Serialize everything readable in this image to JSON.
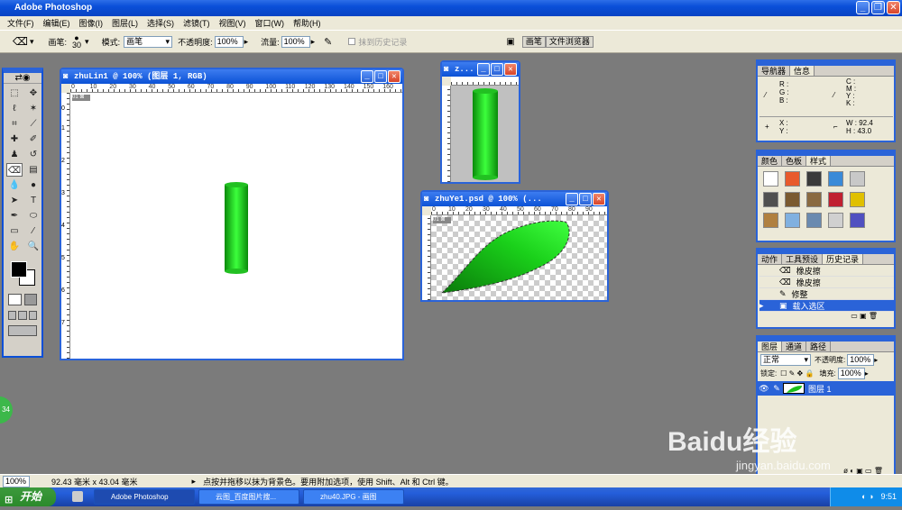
{
  "app": {
    "title": "Adobe Photoshop"
  },
  "menu": [
    "文件(F)",
    "编辑(E)",
    "图像(I)",
    "图层(L)",
    "选择(S)",
    "滤镜(T)",
    "视图(V)",
    "窗口(W)",
    "帮助(H)"
  ],
  "options": {
    "brush_label": "画笔:",
    "brush_size": "30",
    "mode_label": "模式:",
    "mode_value": "画笔",
    "opacity_label": "不透明度:",
    "opacity_value": "100%",
    "flow_label": "流量:",
    "flow_value": "100%",
    "history_label": "抹到历史记录",
    "tab1": "画笔",
    "tab2": "文件浏览器"
  },
  "doc1": {
    "title": "zhuLin1 @ 100% (图层 1, RGB)",
    "ruler_ticks": [
      "0",
      "10",
      "20",
      "30",
      "40",
      "50",
      "60",
      "70",
      "80",
      "90",
      "100",
      "110",
      "120",
      "130",
      "140",
      "150",
      "160"
    ],
    "vruler": [
      "0",
      "1",
      "2",
      "3",
      "4",
      "5",
      "6",
      "7",
      "8"
    ]
  },
  "doc2": {
    "title": "z..."
  },
  "doc3": {
    "title": "zhuYe1.psd @ 100% (...",
    "ruler_ticks": [
      "0",
      "10",
      "20",
      "30",
      "40",
      "50",
      "60",
      "70",
      "80",
      "90"
    ]
  },
  "navigator": {
    "tabs": [
      "导航器",
      "信息"
    ],
    "r": "R :",
    "g": "G :",
    "b": "B :",
    "c": "C :",
    "m": "M :",
    "y": "Y :",
    "k": "K :",
    "x": "X :",
    "y2": "Y :",
    "w": "W :",
    "h": "H :",
    "w_val": "92.4",
    "h_val": "43.0"
  },
  "colors": {
    "tabs": [
      "颜色",
      "色板",
      "样式"
    ],
    "swatches": [
      "#ffffff",
      "#e85a2c",
      "#3a3a3a",
      "#3a8ad8",
      "#c8c8c8",
      "#505050",
      "#7a5a30",
      "#8a6a40",
      "#c02030",
      "#e0c000",
      "#b08040",
      "#80b0e0",
      "#6a8ab0",
      "#d0d0d0",
      "#5050c0"
    ]
  },
  "history": {
    "tabs": [
      "动作",
      "工具预设",
      "历史记录"
    ],
    "items": [
      "橡皮擦",
      "橡皮擦",
      "修整",
      "载入选区"
    ]
  },
  "layers": {
    "tabs": [
      "图层",
      "通道",
      "路径"
    ],
    "mode": "正常",
    "opacity_label": "不透明度:",
    "opacity_value": "100%",
    "lock_label": "锁定:",
    "fill_label": "填充:",
    "fill_value": "100%",
    "layer_name": "图层 1"
  },
  "status": {
    "zoom": "100%",
    "size": "92.43 毫米 x 43.04 毫米",
    "hint": "点按并拖移以抹为背景色。要用附加选项，使用 Shift、Alt 和 Ctrl 键。"
  },
  "taskbar": {
    "start": "开始",
    "tasks": [
      "Adobe Photoshop",
      "云图_百度图片搜...",
      "zhu40.JPG - 画图"
    ],
    "time": "9:51"
  },
  "watermark": {
    "brand": "Baidu经验",
    "url": "jingyan.baidu.com"
  },
  "badge": "34"
}
